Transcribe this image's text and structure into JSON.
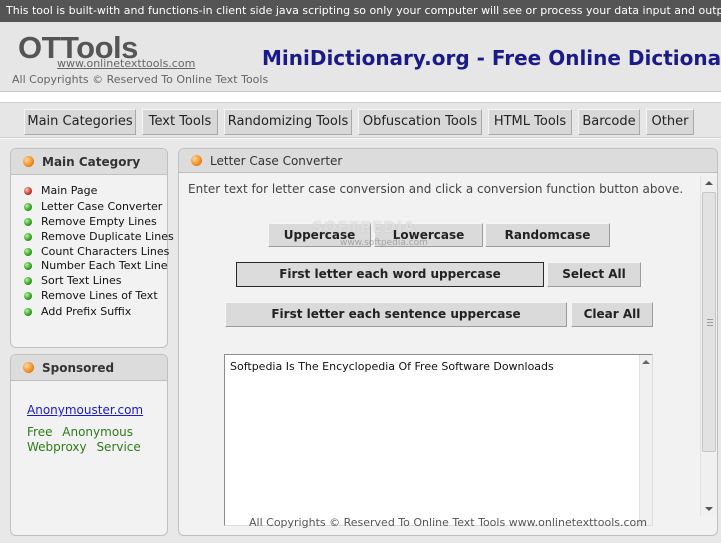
{
  "notice": "This tool is built-with and functions-in client side java scripting so only your computer will see or process your data input and output.",
  "header": {
    "logo": "OTTools",
    "logo_url": "www.onlinetexttools.com",
    "copyright": "All Copyrights © Reserved To Online Text Tools",
    "site_title": "MiniDictionary.org - Free Online Dictionary"
  },
  "nav": {
    "items": [
      "Main Categories",
      "Text Tools",
      "Randomizing Tools",
      "Obfuscation Tools",
      "HTML Tools",
      "Barcode",
      "Other"
    ]
  },
  "sidebar": {
    "title": "Main Category",
    "items": [
      "Main Page",
      "Letter Case Converter",
      "Remove Empty Lines",
      "Remove Duplicate Lines",
      "Count Characters Lines",
      "Number Each Text Line",
      "Sort Text Lines",
      "Remove Lines of Text",
      "Add Prefix Suffix"
    ]
  },
  "sponsored": {
    "title": "Sponsored",
    "link": "Anonymouster.com",
    "text": "Free Anonymous Webproxy Service"
  },
  "main": {
    "title": "Letter Case Converter",
    "instruction": "Enter text for letter case conversion and click a conversion function button above.",
    "buttons": {
      "uppercase": "Uppercase",
      "lowercase": "Lowercase",
      "randomcase": "Randomcase",
      "first_word": "First letter each word uppercase",
      "select_all": "Select All",
      "first_sentence": "First letter each sentence uppercase",
      "clear_all": "Clear All"
    },
    "textarea_value": "Softpedia Is The Encyclopedia Of Free Software Downloads",
    "footer": "All Copyrights © Reserved To Online Text Tools  www.onlinetexttools.com"
  },
  "watermark": {
    "main": "SOFTPEDIA",
    "sub": "www.softpedia.com"
  },
  "colors": {
    "notice_bg": "#555555",
    "title_blue": "#1a1a8a",
    "link_blue": "#1a1acc",
    "sponsor_green": "#2f7a1a"
  }
}
